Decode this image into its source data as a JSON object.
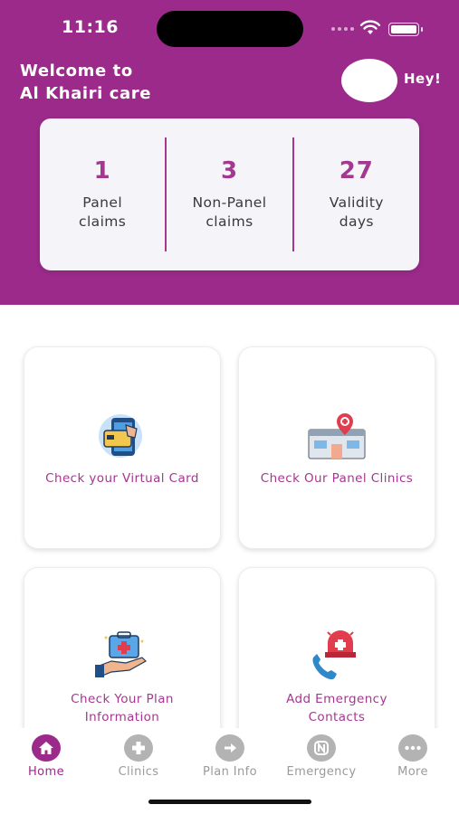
{
  "status_bar": {
    "time": "11:16"
  },
  "header": {
    "welcome_line1": "Welcome to",
    "welcome_line2": "Al Khairi care",
    "greeting": "Hey!"
  },
  "stats": [
    {
      "value": "1",
      "label_line1": "Panel",
      "label_line2": "claims"
    },
    {
      "value": "3",
      "label_line1": "Non-Panel",
      "label_line2": "claims"
    },
    {
      "value": "27",
      "label_line1": "Validity",
      "label_line2": "days"
    }
  ],
  "tiles": [
    {
      "label_line1": "Check your Virtual Card",
      "label_line2": "",
      "icon": "virtual-card-icon"
    },
    {
      "label_line1": "Check Our Panel Clinics",
      "label_line2": "",
      "icon": "clinic-building-icon"
    },
    {
      "label_line1": "Check Your Plan",
      "label_line2": "Information",
      "icon": "plan-info-icon"
    },
    {
      "label_line1": "Add Emergency",
      "label_line2": "Contacts",
      "icon": "emergency-contact-icon"
    }
  ],
  "tabbar": {
    "items": [
      {
        "label": "Home",
        "icon": "home-icon",
        "active": true
      },
      {
        "label": "Clinics",
        "icon": "plus-icon",
        "active": false
      },
      {
        "label": "Plan Info",
        "icon": "arrow-right-icon",
        "active": false
      },
      {
        "label": "Emergency",
        "icon": "emergency-icon",
        "active": false
      },
      {
        "label": "More",
        "icon": "more-dots-icon",
        "active": false
      }
    ]
  },
  "colors": {
    "brand": "#9b2a8a",
    "accent_text": "#a4378f",
    "inactive": "#b3b3b3"
  }
}
